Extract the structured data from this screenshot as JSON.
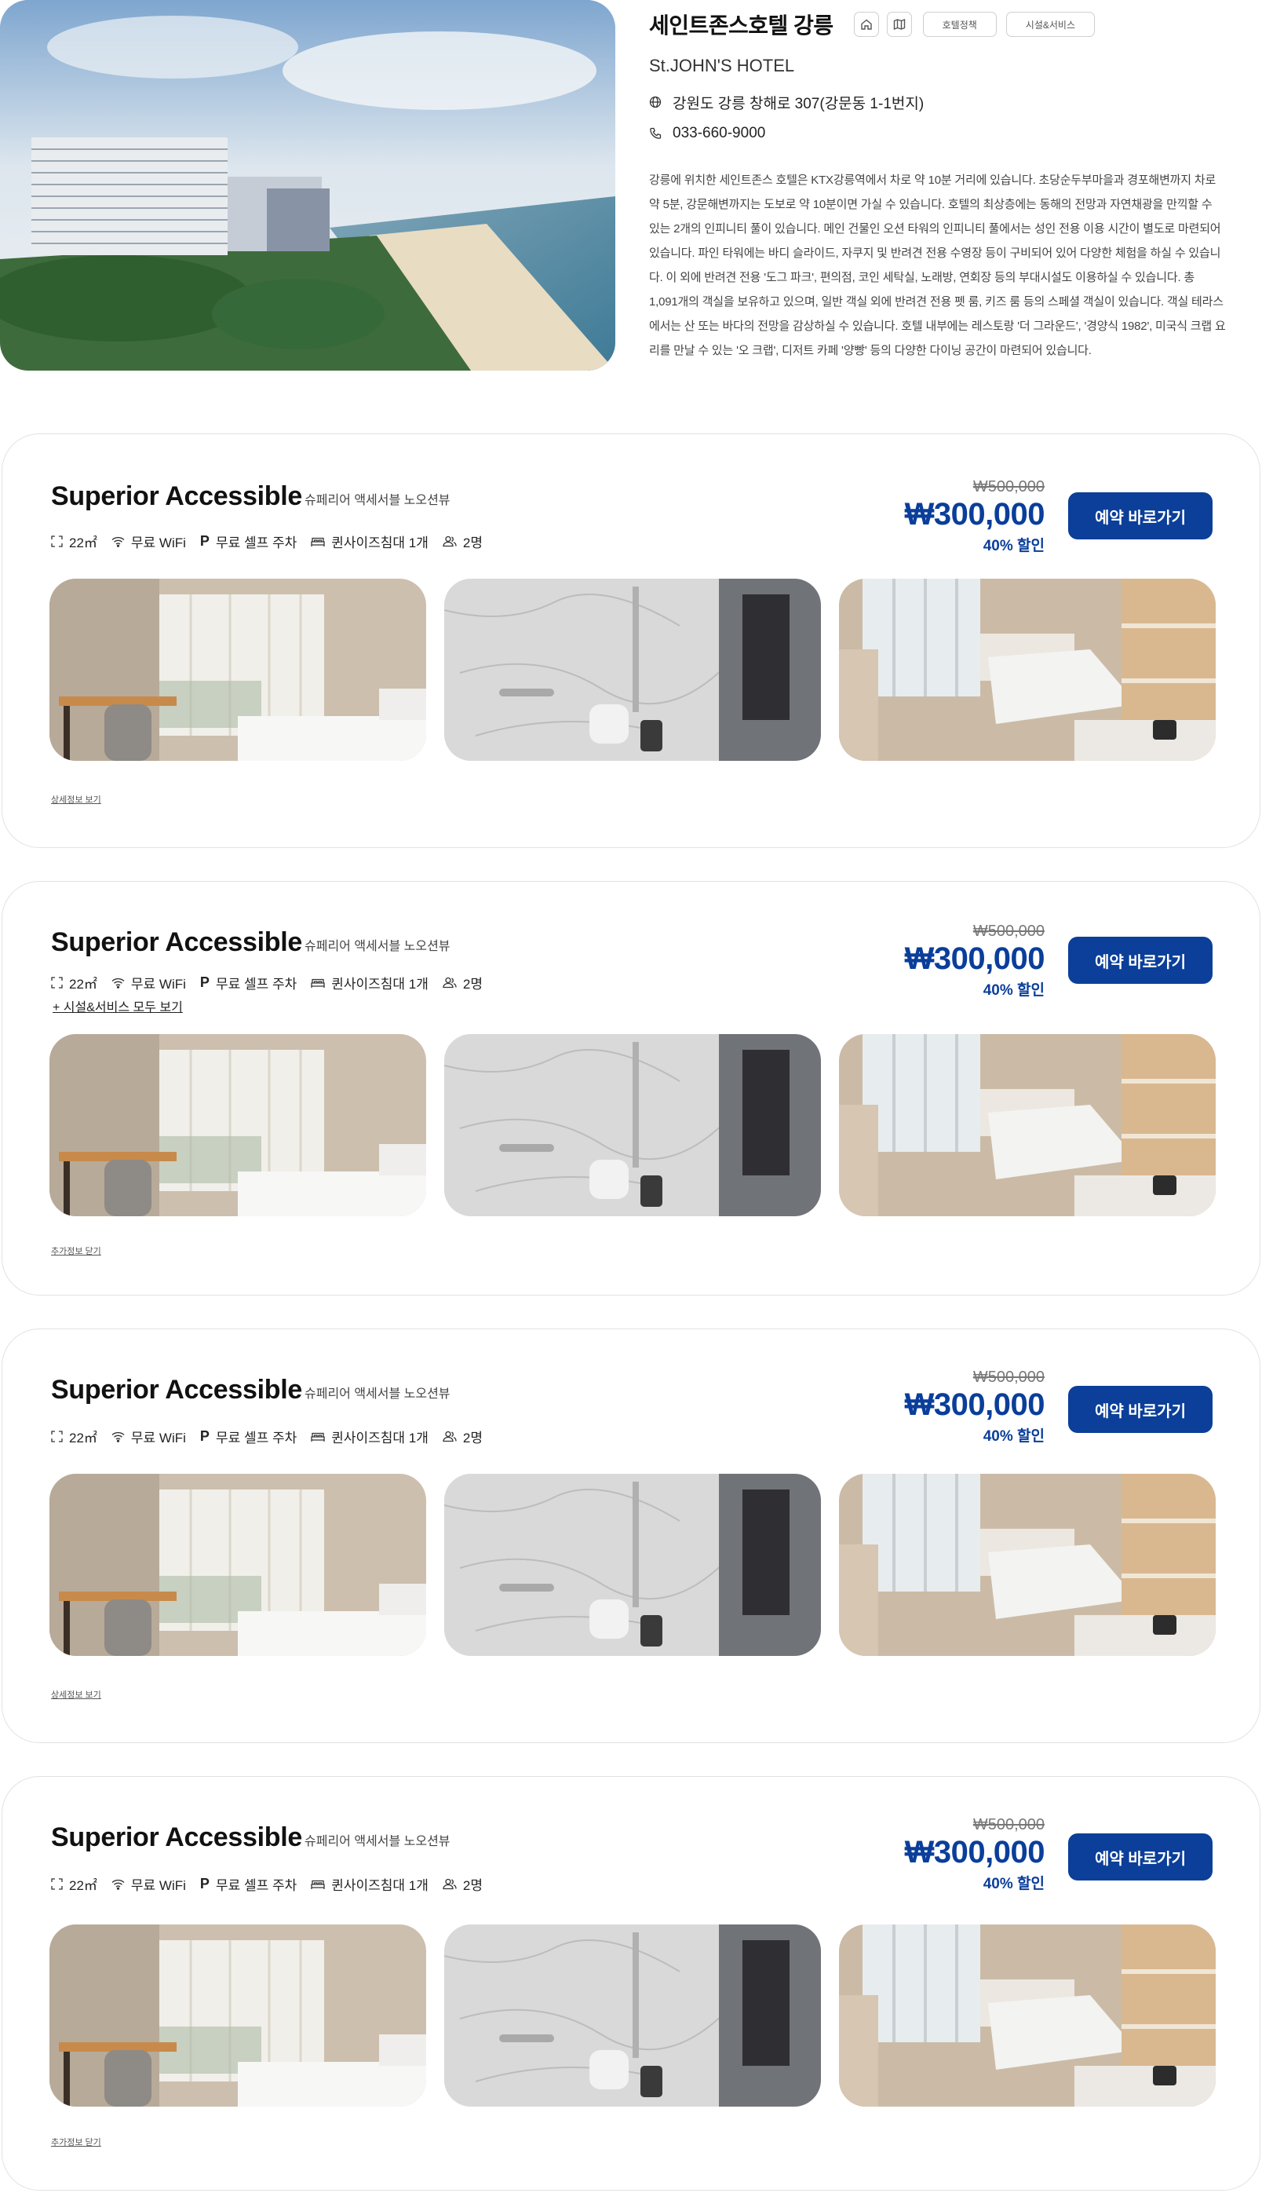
{
  "hotel": {
    "name": "세인트존스호텔 강릉",
    "name_en": "St.JOHN'S HOTEL",
    "address": "강원도 강릉 창해로 307(강문동 1-1번지)",
    "phone": "033-660-9000",
    "policy_btn": "호텔정책",
    "facilities_btn": "시설&서비스",
    "description": "강릉에 위치한 세인트존스 호텔은 KTX강릉역에서 차로 약 10분 거리에 있습니다. 초당순두부마을과 경포해변까지 차로 약 5분, 강문해변까지는 도보로 약 10분이면 가실 수 있습니다. 호텔의 최상층에는 동해의 전망과 자연채광을 만끽할 수 있는 2개의 인피니티 풀이 있습니다. 메인 건물인 오션 타워의 인피니티 풀에서는 성인 전용 이용 시간이 별도로 마련되어 있습니다. 파인 타워에는 바디 슬라이드, 자쿠지 및 반려견 전용 수영장 등이 구비되어 있어 다양한 체험을 하실 수 있습니다. 이 외에 반려견 전용 '도그 파크', 편의점, 코인 세탁실, 노래방, 연회장 등의 부대시설도 이용하실 수 있습니다. 총 1,091개의 객실을 보유하고 있으며, 일반 객실 외에 반려견 전용 펫 룸, 키즈 룸 등의 스페셜 객실이 있습니다. 객실 테라스에서는 산 또는 바다의 전망을 감상하실 수 있습니다. 호텔 내부에는 레스토랑 '더 그라운드', '경양식 1982', 미국식 크랩 요리를 만날 수 있는 '오 크랩', 디저트 카페 '양빵' 등의 다양한 다이닝 공간이 마련되어 있습니다."
  },
  "rooms": [
    {
      "name": "Superior Accessible",
      "subtitle": "슈페리어 액세서블 노오션뷰",
      "amenities": {
        "size": "22㎡",
        "wifi": "무료 WiFi",
        "parking": "무료 셀프 주차",
        "bed": "퀸사이즈침대 1개",
        "guests": "2명"
      },
      "price_original": "₩500,000",
      "price": "₩300,000",
      "discount": "40% 할인",
      "book_label": "예약 바로가기",
      "detail_link": "상세정보 보기"
    },
    {
      "name": "Superior Accessible",
      "subtitle": "슈페리어 액세서블 노오션뷰",
      "amenities": {
        "size": "22㎡",
        "wifi": "무료 WiFi",
        "parking": "무료 셀프 주차",
        "bed": "퀸사이즈침대 1개",
        "guests": "2명"
      },
      "show_all": "+ 시설&서비스 모두 보기",
      "price_original": "₩500,000",
      "price": "₩300,000",
      "discount": "40% 할인",
      "book_label": "예약 바로가기",
      "detail_link": "추가정보 닫기"
    },
    {
      "name": "Superior Accessible",
      "subtitle": "슈페리어 액세서블 노오션뷰",
      "amenities": {
        "size": "22㎡",
        "wifi": "무료 WiFi",
        "parking": "무료 셀프 주차",
        "bed": "퀸사이즈침대 1개",
        "guests": "2명"
      },
      "price_original": "₩500,000",
      "price": "₩300,000",
      "discount": "40% 할인",
      "book_label": "예약 바로가기",
      "detail_link": "상세정보 보기"
    },
    {
      "name": "Superior Accessible",
      "subtitle": "슈페리어 액세서블 노오션뷰",
      "amenities": {
        "size": "22㎡",
        "wifi": "무료 WiFi",
        "parking": "무료 셀프 주차",
        "bed": "퀸사이즈침대 1개",
        "guests": "2명"
      },
      "price_original": "₩500,000",
      "price": "₩300,000",
      "discount": "40% 할인",
      "book_label": "예약 바로가기",
      "detail_link": "추가정보 닫기"
    }
  ],
  "icons": {
    "home": "home-icon",
    "map": "map-icon",
    "globe": "globe-icon",
    "phone": "phone-icon",
    "size": "area-icon",
    "wifi": "wifi-icon",
    "parking": "parking-icon",
    "bed": "bed-icon",
    "guests": "users-icon"
  },
  "colors": {
    "accent": "#0b3f99",
    "price": "#0a3e9a",
    "border": "#e2e2e2"
  }
}
